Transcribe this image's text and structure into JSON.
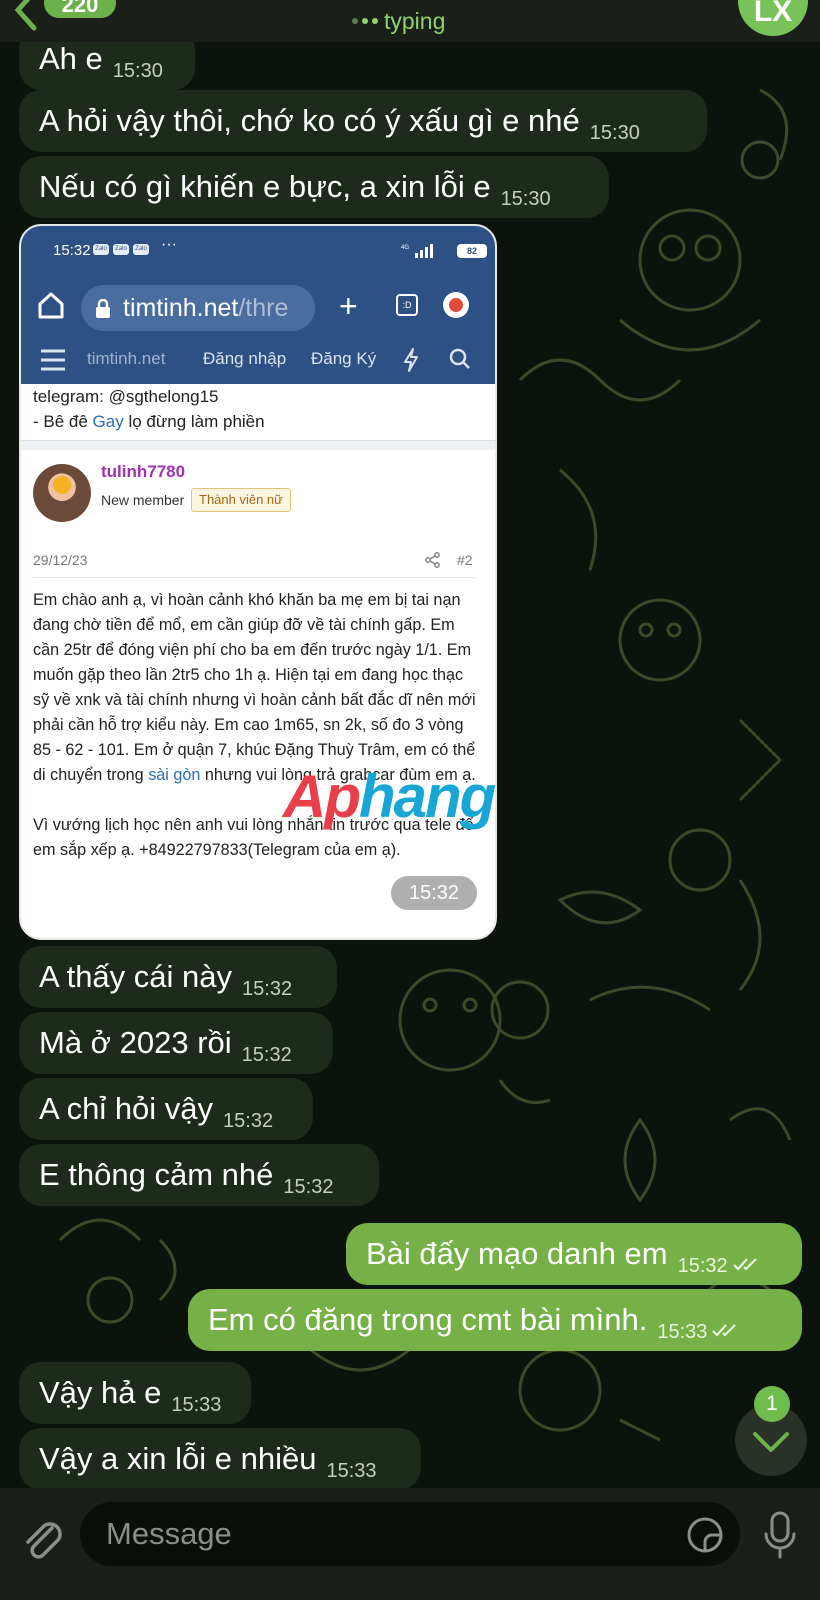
{
  "header": {
    "back_unread": "220",
    "status": "typing",
    "avatar_initials": "LX"
  },
  "messages_before": [
    {
      "text": "Ah e",
      "time": "15:30"
    },
    {
      "text": "A hỏi vậy thôi, chớ ko có ý xấu gì e nhé",
      "time": "15:30"
    },
    {
      "text": "Nếu có gì khiến e bực, a xin lỗi e",
      "time": "15:30"
    }
  ],
  "screenshot": {
    "time": "15:32",
    "status_apps": [
      "Zalo",
      "Zalo",
      "Zalo"
    ],
    "status_more": "···",
    "network": "4G",
    "battery": "82",
    "url_host": "timtinh.net",
    "url_rest": "/thre",
    "tabs_label": ":D",
    "nav_brand": "timtinh.net",
    "nav_login": "Đăng nhập",
    "nav_register": "Đăng Ký",
    "prev_telegram": "telegram: @sgthelong15",
    "prev_line_a": "- Bê đê ",
    "prev_link": "Gay",
    "prev_line_b": " lọ đừng làm phiền",
    "username": "tulinh7780",
    "role": "New member",
    "badge": "Thành viên nữ",
    "date": "29/12/23",
    "post_num": "#2",
    "body_a": "Em chào anh ạ, vì hoàn cảnh khó khăn ba mẹ em bị tai nạn đang chờ tiền để mổ, em cần giúp đỡ về tài chính gấp. Em cần 25tr để đóng viện phí cho ba em đến trước ngày 1/1. Em muốn gặp theo lần 2tr5 cho 1h ạ. Hiện tại em đang học thạc sỹ về xnk và tài chính nhưng vì hoàn cảnh bất đắc dĩ nên mới phải cần hỗ trợ kiểu này. Em cao 1m65, sn 2k, số đo 3 vòng 85 - 62 - 101. Em ở quận 7, khúc Đặng Thuỳ Trâm, em có thể di chuyển trong ",
    "body_link": "sài gòn",
    "body_b": " nhưng vui lòng trả grabcar đùm em ạ.",
    "body_c": "Vì vướng lịch học nên anh vui lòng nhắn tin trước qua tele để em sắp xếp ạ. +84922797833(Telegram của em ạ).",
    "message_time": "15:32"
  },
  "watermark": {
    "part1": "Ap",
    "part2": "hang"
  },
  "messages_after": [
    {
      "text": "A thấy cái này",
      "time": "15:32"
    },
    {
      "text": "Mà ở 2023 rồi",
      "time": "15:32"
    },
    {
      "text": "A chỉ hỏi vậy",
      "time": "15:32"
    },
    {
      "text": "E thông cảm nhé",
      "time": "15:32"
    }
  ],
  "outgoing": [
    {
      "text": "Bài đấy mạo danh em",
      "time": "15:32"
    },
    {
      "text": "Em có đăng trong cmt bài mình.",
      "time": "15:33"
    }
  ],
  "messages_last": [
    {
      "text": "Vậy hả e",
      "time": "15:33"
    },
    {
      "text": "Vậy a xin lỗi e nhiều",
      "time": "15:33"
    }
  ],
  "unread_count": "1",
  "composer": {
    "placeholder": "Message"
  },
  "colors": {
    "incoming": "#1e2a1c",
    "outgoing": "#76b147",
    "accent": "#6cb14a",
    "wallpaper": "#0c120c"
  },
  "icons": [
    "back-chevron-icon",
    "typing-dots-icon",
    "attach-icon",
    "sticker-icon",
    "mic-icon",
    "chevron-down-icon",
    "double-check-icon"
  ]
}
